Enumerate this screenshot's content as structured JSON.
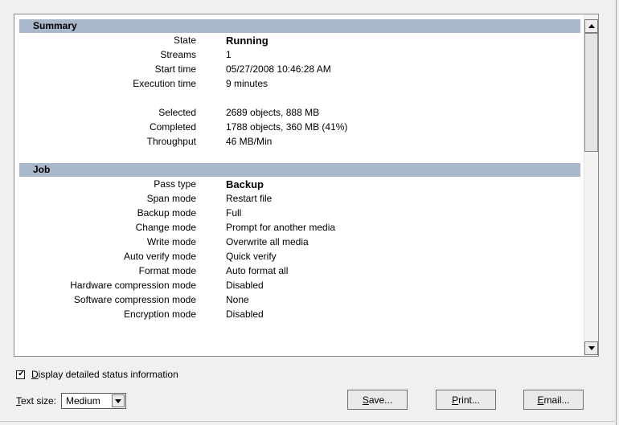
{
  "summary": {
    "header": "Summary",
    "rows": [
      {
        "label": "State",
        "value": "Running"
      },
      {
        "label": "Streams",
        "value": "1"
      },
      {
        "label": "Start time",
        "value": "05/27/2008 10:46:28 AM"
      },
      {
        "label": "Execution time",
        "value": "9 minutes"
      },
      {
        "label": "Selected",
        "value": "2689 objects, 888 MB"
      },
      {
        "label": "Completed",
        "value": "1788 objects, 360 MB (41%)"
      },
      {
        "label": "Throughput",
        "value": "46 MB/Min"
      }
    ]
  },
  "job": {
    "header": "Job",
    "rows": [
      {
        "label": "Pass type",
        "value": "Backup"
      },
      {
        "label": "Span mode",
        "value": "Restart file"
      },
      {
        "label": "Backup mode",
        "value": "Full"
      },
      {
        "label": "Change mode",
        "value": "Prompt for another media"
      },
      {
        "label": "Write mode",
        "value": "Overwrite all media"
      },
      {
        "label": "Auto verify mode",
        "value": "Quick verify"
      },
      {
        "label": "Format mode",
        "value": "Auto format all"
      },
      {
        "label": "Hardware compression mode",
        "value": "Disabled"
      },
      {
        "label": "Software compression mode",
        "value": "None"
      },
      {
        "label": "Encryption mode",
        "value": "Disabled"
      }
    ]
  },
  "options": {
    "detailed_status": {
      "checked": true,
      "label_accel": "D",
      "label_rest": "isplay detailed status information"
    },
    "text_size": {
      "label_accel": "T",
      "label_rest": "ext size:",
      "selected": "Medium"
    }
  },
  "buttons": {
    "save": {
      "accel": "S",
      "rest": "ave..."
    },
    "print": {
      "accel": "P",
      "rest": "rint..."
    },
    "email": {
      "accel": "E",
      "rest": "mail..."
    }
  },
  "icons": {
    "scroll_up": "arrow-up-icon",
    "scroll_down": "arrow-down-icon",
    "dropdown": "chevron-down-icon",
    "checkbox": "check-icon"
  },
  "colors": {
    "section_header_bg": "#aab8cc",
    "window_bg": "#f0f0f0"
  }
}
